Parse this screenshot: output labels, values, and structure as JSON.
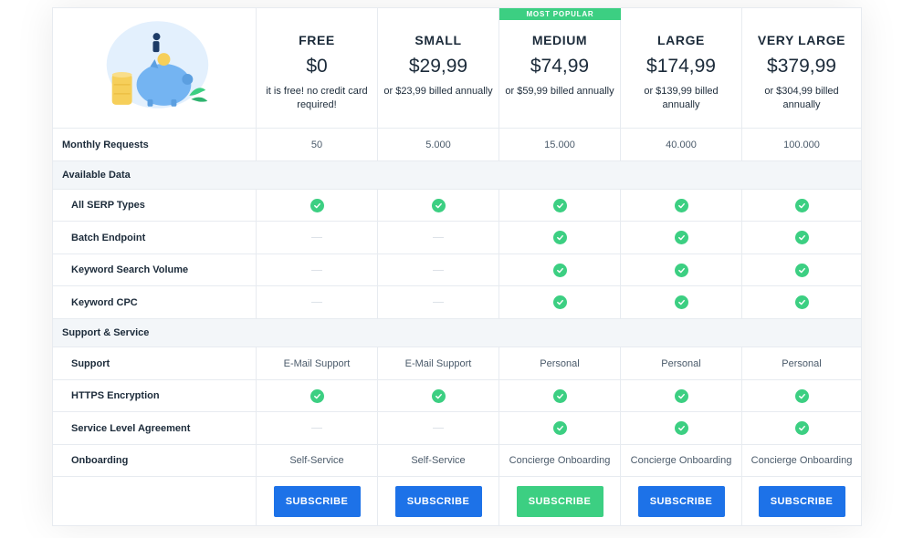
{
  "badge": "MOST POPULAR",
  "plans": [
    {
      "name": "FREE",
      "price": "$0",
      "note": "it is free! no credit card required!",
      "requests": "50",
      "support": "E-Mail Support",
      "onboarding": "Self-Service",
      "cta": "SUBSCRIBE"
    },
    {
      "name": "SMALL",
      "price": "$29,99",
      "note": "or $23,99 billed annually",
      "requests": "5.000",
      "support": "E-Mail Support",
      "onboarding": "Self-Service",
      "cta": "SUBSCRIBE"
    },
    {
      "name": "MEDIUM",
      "price": "$74,99",
      "note": "or $59,99 billed annually",
      "requests": "15.000",
      "support": "Personal",
      "onboarding": "Concierge Onboarding",
      "cta": "SUBSCRIBE"
    },
    {
      "name": "LARGE",
      "price": "$174,99",
      "note": "or $139,99 billed annually",
      "requests": "40.000",
      "support": "Personal",
      "onboarding": "Concierge Onboarding",
      "cta": "SUBSCRIBE"
    },
    {
      "name": "VERY LARGE",
      "price": "$379,99",
      "note": "or $304,99 billed annually",
      "requests": "100.000",
      "support": "Personal",
      "onboarding": "Concierge Onboarding",
      "cta": "SUBSCRIBE"
    }
  ],
  "features": {
    "monthly_requests": "Monthly Requests",
    "section_data": "Available Data",
    "all_serp": "All SERP Types",
    "batch": "Batch Endpoint",
    "ksv": "Keyword Search Volume",
    "kcpc": "Keyword CPC",
    "section_support": "Support & Service",
    "support": "Support",
    "https": "HTTPS Encryption",
    "sla": "Service Level Agreement",
    "onboarding": "Onboarding"
  },
  "availability": {
    "all_serp": [
      true,
      true,
      true,
      true,
      true
    ],
    "batch": [
      false,
      false,
      true,
      true,
      true
    ],
    "ksv": [
      false,
      false,
      true,
      true,
      true
    ],
    "kcpc": [
      false,
      false,
      true,
      true,
      true
    ],
    "https": [
      true,
      true,
      true,
      true,
      true
    ],
    "sla": [
      false,
      false,
      true,
      true,
      true
    ]
  },
  "icons": {
    "included": "check-circle-icon",
    "excluded": "dash-icon",
    "illustration": "piggy-bank-illustration"
  },
  "colors": {
    "accent_green": "#3ccf82",
    "button_blue": "#1d72e8",
    "piggy_blue": "#74b4f2"
  }
}
